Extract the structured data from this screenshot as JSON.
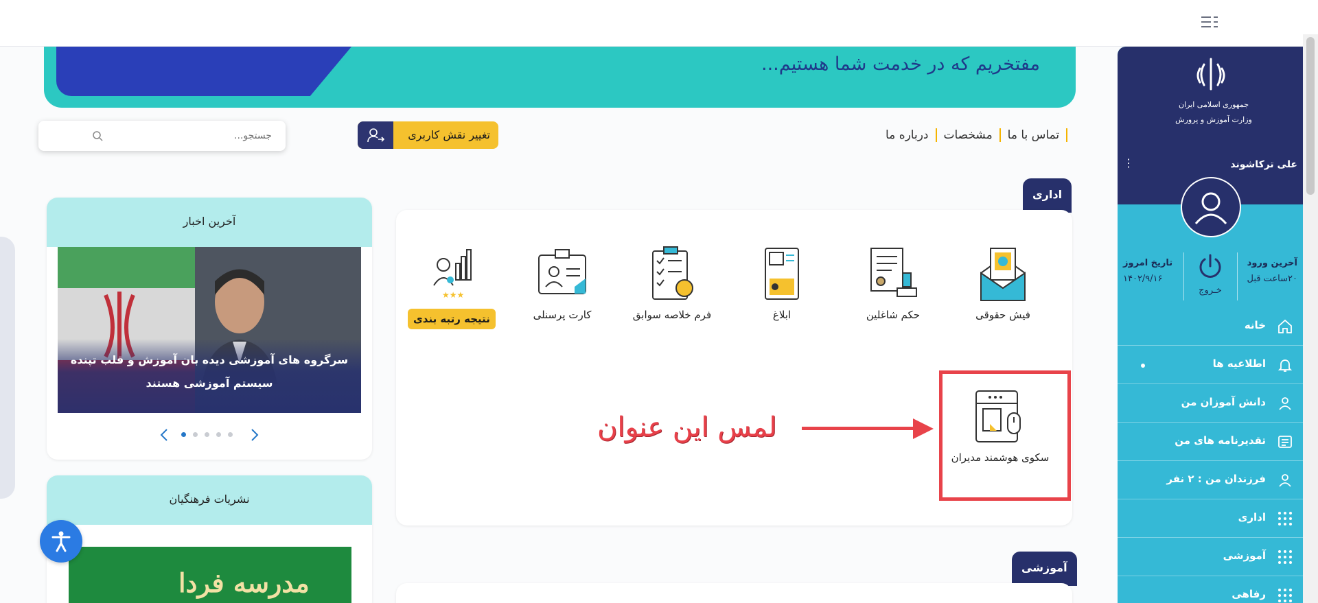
{
  "banner": {
    "text": "مفتخریم که در خدمت شما هستیم..."
  },
  "nav": {
    "links": [
      "تماس با ما",
      "مشخصات",
      "درباره ما"
    ]
  },
  "role_button": {
    "label": "تغییر نقش کاربری",
    "icon": "user-switch-icon"
  },
  "search": {
    "placeholder": "جستجو...",
    "icon": "search-icon"
  },
  "sidebar": {
    "org_line1": "جمهوری اسلامی ایران",
    "org_line2": "وزارت آموزش و پرورش",
    "user_name": "علی ترکاشوند",
    "last_login_label": "آخرین ورود",
    "last_login_value": "۲۰ساعت قبل",
    "today_label": "تاریخ امروز",
    "today_value": "۱۴۰۲/۹/۱۶",
    "logout_label": "خـروج",
    "items": [
      {
        "label": "خانه",
        "icon": "home-icon"
      },
      {
        "label": "اطلاعیه ها",
        "icon": "bell-icon"
      },
      {
        "label": "دانش آموزان من",
        "icon": "user-icon"
      },
      {
        "label": "تقدیرنامه های من",
        "icon": "certificate-icon"
      },
      {
        "label": "فرزندان من : ۲ نفر",
        "icon": "user-icon"
      },
      {
        "label": "اداری",
        "icon": "grid-icon"
      },
      {
        "label": "آموزشی",
        "icon": "grid-icon"
      },
      {
        "label": "رفاهی",
        "icon": "grid-icon"
      }
    ]
  },
  "sections": {
    "admin_tag": "اداری",
    "edu_tag": "آموزشی"
  },
  "tiles": [
    {
      "label": "فیش حقوقی",
      "icon": "payslip-icon"
    },
    {
      "label": "حکم شاغلین",
      "icon": "decree-icon"
    },
    {
      "label": "ابلاغ",
      "icon": "notice-icon"
    },
    {
      "label": "فرم خلاصه سوابق",
      "icon": "checklist-icon"
    },
    {
      "label": "کارت پرسنلی",
      "icon": "id-card-icon"
    },
    {
      "label": "نتیجه رتبه بندی",
      "icon": "ranking-icon"
    },
    {
      "label": "سکوی هوشمند مدیران",
      "icon": "smart-platform-icon"
    }
  ],
  "annotation": {
    "text": "لمس این عنوان"
  },
  "news": {
    "title": "آخرین اخبار",
    "caption": "سرگروه های آموزشی دیده بان آموزش و قلب تپنده سیستم آموزشی هستند",
    "slide_count": 5,
    "active_slide": 1
  },
  "publications": {
    "title": "نشریات فرهنگیان",
    "cover_title": "مدرسه فردا"
  },
  "accessibility": {
    "icon": "accessibility-icon"
  },
  "colors": {
    "sidebar_dark": "#27306b",
    "sidebar_light": "#35b9d6",
    "banner": "#2cc8c2",
    "accent_yellow": "#f5c12e",
    "annotation_red": "#e8434a"
  }
}
